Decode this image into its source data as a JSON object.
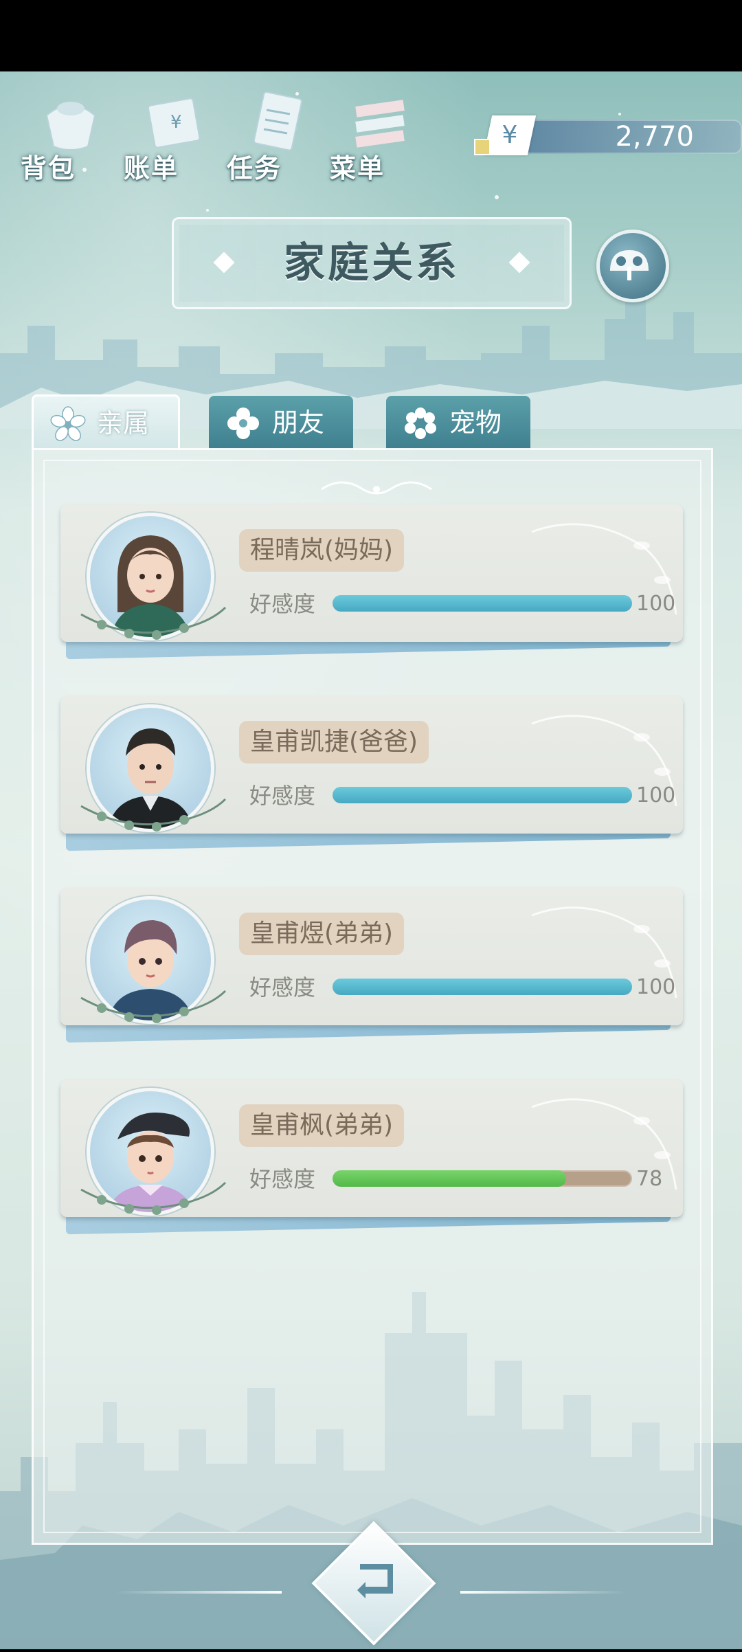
{
  "nav": {
    "items": [
      {
        "label": "背包",
        "icon": "bag-icon"
      },
      {
        "label": "账单",
        "icon": "bill-icon"
      },
      {
        "label": "任务",
        "icon": "task-icon"
      },
      {
        "label": "菜单",
        "icon": "menu-icon"
      }
    ]
  },
  "currency": {
    "symbol": "¥",
    "amount": "2,770"
  },
  "title": "家庭关系",
  "tabs": [
    {
      "label": "亲属",
      "active": true
    },
    {
      "label": "朋友",
      "active": false
    },
    {
      "label": "宠物",
      "active": false
    }
  ],
  "affection_label": "好感度",
  "members": [
    {
      "name": "程晴岚(妈妈)",
      "affection": 100,
      "max": 100,
      "bar_color": "blue"
    },
    {
      "name": "皇甫凯捷(爸爸)",
      "affection": 100,
      "max": 100,
      "bar_color": "blue"
    },
    {
      "name": "皇甫煜(弟弟)",
      "affection": 100,
      "max": 100,
      "bar_color": "blue"
    },
    {
      "name": "皇甫枫(弟弟)",
      "affection": 78,
      "max": 100,
      "bar_color": "green"
    }
  ],
  "colors": {
    "bar_blue": "#46a9c2",
    "bar_green": "#53b84a",
    "bar_track": "#b6a08a",
    "name_tag": "#e2d3c0"
  }
}
